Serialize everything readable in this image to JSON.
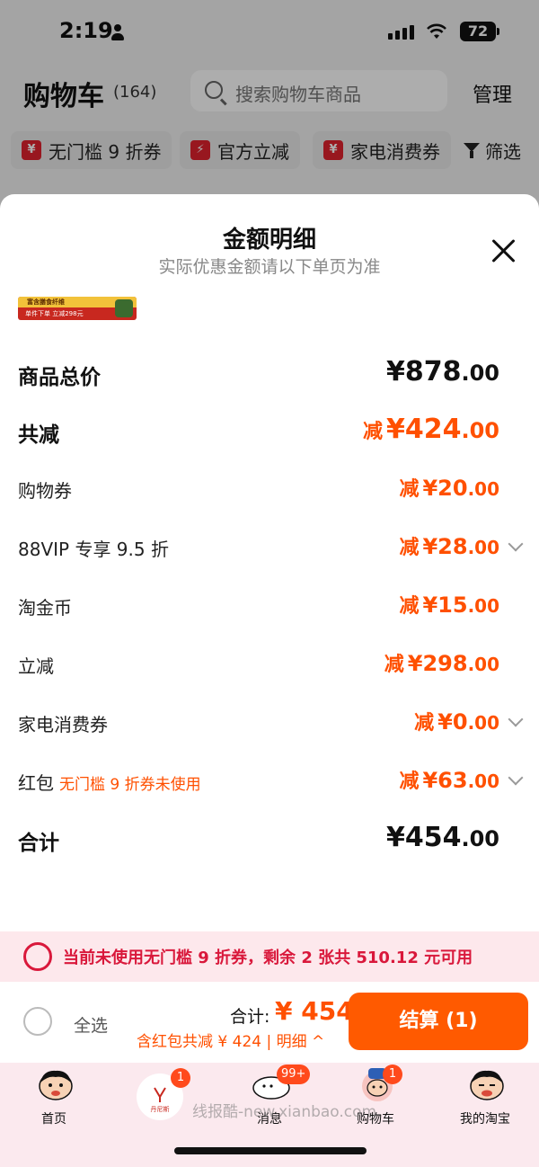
{
  "status_bar": {
    "time": "2:19",
    "battery": "72"
  },
  "header": {
    "title": "购物车",
    "count": "(164)",
    "search_placeholder": "搜索购物车商品",
    "manage": "管理"
  },
  "filters": [
    {
      "label": "无门槛 9 折券",
      "icon": "¥"
    },
    {
      "label": "官方立减",
      "icon": "⚡"
    },
    {
      "label": "家电消费券",
      "icon": "¥"
    }
  ],
  "filter_button": "筛选",
  "sheet": {
    "title": "金额明细",
    "subtitle": "实际优惠金额请以下单页为准",
    "promo_banner": {
      "top": "富含膳食纤维",
      "bottom": "单件下单 立减298元"
    },
    "rows": [
      {
        "label": "商品总价",
        "prefix": "",
        "int": "¥878",
        "dec": ".00",
        "style": "total"
      },
      {
        "label": "共减",
        "prefix": "减",
        "int": "¥424",
        "dec": ".00",
        "style": "discount-big"
      },
      {
        "label": "购物券",
        "prefix": "减",
        "int": "¥20",
        "dec": ".00",
        "style": "discount"
      },
      {
        "label": "88VIP 专享 9.5 折",
        "prefix": "减",
        "int": "¥28",
        "dec": ".00",
        "style": "discount",
        "expandable": true
      },
      {
        "label": "淘金币",
        "prefix": "减",
        "int": "¥15",
        "dec": ".00",
        "style": "discount"
      },
      {
        "label": "立减",
        "prefix": "减",
        "int": "¥298",
        "dec": ".00",
        "style": "discount"
      },
      {
        "label": "家电消费券",
        "prefix": "减",
        "int": "¥0",
        "dec": ".00",
        "style": "discount",
        "expandable": true
      },
      {
        "label": "红包",
        "note": "无门槛 9 折券未使用",
        "prefix": "减",
        "int": "¥63",
        "dec": ".00",
        "style": "discount",
        "expandable": true
      },
      {
        "label": "合计",
        "prefix": "",
        "int": "¥454",
        "dec": ".00",
        "style": "total"
      }
    ]
  },
  "notice": {
    "text": "当前未使用无门槛 9 折券，剩余 2 张共 510.12 元可用"
  },
  "checkout": {
    "select_all": "全选",
    "total_label": "合计:",
    "total_value": "¥ 454",
    "detail": "含红包共减 ¥ 424 | 明细 ^",
    "button": "结算 (1)"
  },
  "tabbar": {
    "tabs": [
      {
        "label": "首页",
        "badge": ""
      },
      {
        "label": "",
        "badge": "1"
      },
      {
        "label": "消息",
        "badge": "99+"
      },
      {
        "label": "购物车",
        "badge": "1"
      },
      {
        "label": "我的淘宝",
        "badge": ""
      }
    ],
    "center_logo": "丹尼斯"
  },
  "watermark": "线报酷-new.xianbao.com",
  "colors": {
    "accent": "#ff5000",
    "coupon_red": "#d9183b",
    "checkout_button": "#ff5a00"
  }
}
